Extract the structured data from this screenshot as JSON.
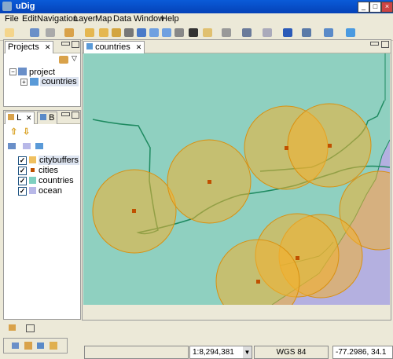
{
  "window": {
    "title": "uDig"
  },
  "menu": [
    "File",
    "Edit",
    "Navigation",
    "Layer",
    "Map",
    "Data",
    "Window",
    "Help"
  ],
  "projects_panel": {
    "tab": "Projects",
    "root": "project",
    "child": "countries"
  },
  "layers_panel": {
    "tab1": "L",
    "tab2": "B",
    "layers": [
      {
        "name": "citybuffers",
        "checked": true,
        "color": "#f0c060"
      },
      {
        "name": "cities",
        "checked": true,
        "color": "#c05000"
      },
      {
        "name": "countries",
        "checked": true,
        "color": "#7fd0c0"
      },
      {
        "name": "ocean",
        "checked": true,
        "color": "#b8b8e8"
      }
    ]
  },
  "map": {
    "tab": "countries",
    "land_color": "#8fd0c0",
    "ocean_color": "#b4b0e0",
    "buffer_color": "#f2b030",
    "border_color": "#1e8a60"
  },
  "status": {
    "scale": "1:8,294,381",
    "crs": "WGS 84",
    "coords": "-77.2986, 34.1"
  }
}
